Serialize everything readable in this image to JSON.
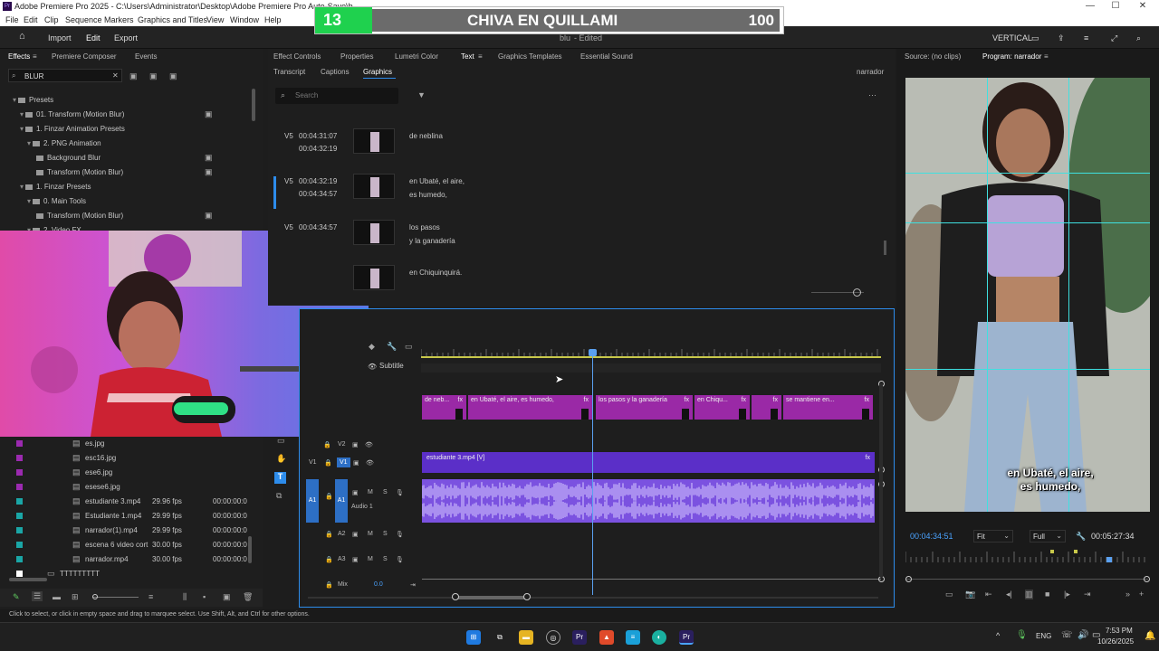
{
  "window": {
    "title": "Adobe Premiere Pro 2025 - C:\\Users\\Administrator\\Desktop\\Adobe Premiere Pro Auto-Save\\b",
    "menus": [
      "File",
      "Edit",
      "Clip",
      "Sequence",
      "Markers",
      "Graphics and Titles",
      "View",
      "Window",
      "Help"
    ]
  },
  "scoreboard": {
    "left_score": "13",
    "name": "CHIVA EN QUILLAMI",
    "right_score": "100"
  },
  "header": {
    "tabs": [
      "Import",
      "Edit",
      "Export"
    ],
    "project": "blu",
    "status": "- Edited",
    "workspace": "VERTICAL"
  },
  "effects_panel": {
    "tabs": [
      "Effects",
      "Premiere Composer",
      "Events"
    ],
    "search_value": "BLUR",
    "tree": [
      {
        "label": "Presets",
        "level": 0
      },
      {
        "label": "01. Transform (Motion Blur)",
        "level": 1
      },
      {
        "label": "1. Finzar Animation Presets",
        "level": 1
      },
      {
        "label": "2. PNG Animation",
        "level": 2
      },
      {
        "label": "Background Blur",
        "level": 3
      },
      {
        "label": "Transform (Motion Blur)",
        "level": 3
      },
      {
        "label": "1. Finzar Presets",
        "level": 1
      },
      {
        "label": "0. Main Tools",
        "level": 2
      },
      {
        "label": "Transform (Motion Blur)",
        "level": 3
      },
      {
        "label": "2. Video FX",
        "level": 2
      }
    ]
  },
  "project_items": [
    {
      "name": "es.jpg",
      "fps": "",
      "dur": "",
      "color": "#9b2ab0"
    },
    {
      "name": "esc16.jpg",
      "fps": "",
      "dur": "",
      "color": "#9b2ab0"
    },
    {
      "name": "ese6.jpg",
      "fps": "",
      "dur": "",
      "color": "#9b2ab0"
    },
    {
      "name": "esese6.jpg",
      "fps": "",
      "dur": "",
      "color": "#9b2ab0"
    },
    {
      "name": "estudiante 3.mp4",
      "fps": "29.96 fps",
      "dur": "00:00:00:0",
      "color": "#1aa6a6"
    },
    {
      "name": "Estudiante 1.mp4",
      "fps": "29.99 fps",
      "dur": "00:00:00:0",
      "color": "#1aa6a6"
    },
    {
      "name": "narrador(1).mp4",
      "fps": "29.99 fps",
      "dur": "00:00:00:0",
      "color": "#1aa6a6"
    },
    {
      "name": "escena 6 video cort",
      "fps": "30.00 fps",
      "dur": "00:00:00:0",
      "color": "#1aa6a6"
    },
    {
      "name": "narrador.mp4",
      "fps": "30.00 fps",
      "dur": "00:00:00:0",
      "color": "#1aa6a6"
    },
    {
      "name": "TTTTTTTTT",
      "fps": "",
      "dur": "",
      "color": "#ffffff"
    }
  ],
  "text_panel": {
    "tabs": [
      "Effect Controls",
      "Properties",
      "Lumetri Color",
      "Text",
      "Graphics Templates",
      "Essential Sound"
    ],
    "subtabs": [
      "Transcript",
      "Captions",
      "Graphics"
    ],
    "sequence_name": "narrador",
    "search_placeholder": "Search",
    "captions": [
      {
        "track": "V5",
        "start": "00:04:31:07",
        "end": "00:04:32:19",
        "line1": "de neblina",
        "line2": ""
      },
      {
        "track": "V5",
        "start": "00:04:32:19",
        "end": "00:04:34:57",
        "line1": "en Ubaté, el aire,",
        "line2": "es humedo,"
      },
      {
        "track": "V5",
        "start": "00:04:34:57",
        "end": "",
        "line1": "los pasos",
        "line2": "y la ganadería"
      },
      {
        "track": "",
        "start": "",
        "end": "",
        "line1": "en Chiquinquirá.",
        "line2": ""
      }
    ]
  },
  "timeline": {
    "subtitle_label": "Subtitle",
    "subtitle_clips": [
      {
        "label": "de neb...",
        "fx": "fx"
      },
      {
        "label": "en Ubaté, el aire, es humedo,",
        "fx": "fx"
      },
      {
        "label": "los pasos y la ganadería",
        "fx": "fx"
      },
      {
        "label": "en Chiqu...",
        "fx": "fx"
      },
      {
        "label": "",
        "fx": "fx"
      },
      {
        "label": "se mantiene en...",
        "fx": "fx"
      }
    ],
    "video_clip": "estudiante 3.mp4 [V]",
    "tracks": [
      "V2",
      "V1",
      "A1",
      "A2",
      "A3"
    ],
    "audio_name": "Audio 1",
    "mix_label": "Mix",
    "mix_value": "0.0"
  },
  "monitor": {
    "source_label": "Source: (no clips)",
    "program_label": "Program: narrador",
    "subtitle_line1": "en Ubaté, el aire,",
    "subtitle_line2": "es humedo,",
    "current_time": "00:04:34:51",
    "zoom": "Fit",
    "quality": "Full",
    "duration": "00:05:27:34"
  },
  "status_bar": "Click to select, or click in empty space and drag to marquee select. Use Shift, Alt, and Ctrl for other options.",
  "taskbar": {
    "lang": "ENG",
    "time": "7:53 PM",
    "date": "10/26/2025"
  },
  "colors": {
    "accent_blue": "#2d8ceb",
    "subtitle_clip": "#9a29a6",
    "video_clip": "#5b2fc8",
    "audio_clip": "#7b52e0"
  }
}
